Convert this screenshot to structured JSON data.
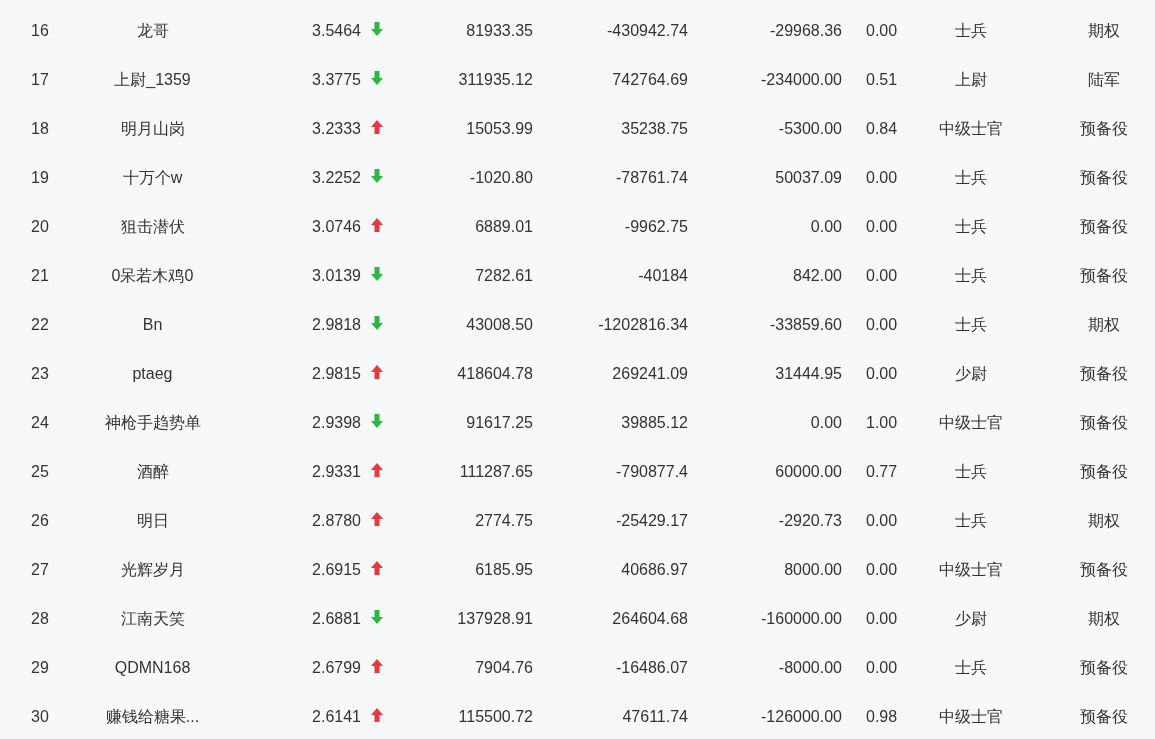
{
  "table": {
    "rows": [
      {
        "column_1": "16",
        "column_2": "龙哥",
        "column_3": "3.5464",
        "rising": false,
        "column_4": "81933.35",
        "column_5": "-430942.74",
        "column_6": "-29968.36",
        "column_7": "0.00",
        "column_8": "士兵",
        "column_9": "期权"
      },
      {
        "column_1": "17",
        "column_2": "上尉_1359",
        "column_3": "3.3775",
        "rising": false,
        "column_4": "311935.12",
        "column_5": "742764.69",
        "column_6": "-234000.00",
        "column_7": "0.51",
        "column_8": "上尉",
        "column_9": "陆军"
      },
      {
        "column_1": "18",
        "column_2": "明月山岗",
        "column_3": "3.2333",
        "rising": true,
        "column_4": "15053.99",
        "column_5": "35238.75",
        "column_6": "-5300.00",
        "column_7": "0.84",
        "column_8": "中级士官",
        "column_9": "预备役"
      },
      {
        "column_1": "19",
        "column_2": "十万个w",
        "column_3": "3.2252",
        "rising": false,
        "column_4": "-1020.80",
        "column_5": "-78761.74",
        "column_6": "50037.09",
        "column_7": "0.00",
        "column_8": "士兵",
        "column_9": "预备役"
      },
      {
        "column_1": "20",
        "column_2": "狙击潜伏",
        "column_3": "3.0746",
        "rising": true,
        "column_4": "6889.01",
        "column_5": "-9962.75",
        "column_6": "0.00",
        "column_7": "0.00",
        "column_8": "士兵",
        "column_9": "预备役"
      },
      {
        "column_1": "21",
        "column_2": "0呆若木鸡0",
        "column_3": "3.0139",
        "rising": false,
        "column_4": "7282.61",
        "column_5": "-40184",
        "column_6": "842.00",
        "column_7": "0.00",
        "column_8": "士兵",
        "column_9": "预备役"
      },
      {
        "column_1": "22",
        "column_2": "Bn",
        "column_3": "2.9818",
        "rising": false,
        "column_4": "43008.50",
        "column_5": "-1202816.34",
        "column_6": "-33859.60",
        "column_7": "0.00",
        "column_8": "士兵",
        "column_9": "期权"
      },
      {
        "column_1": "23",
        "column_2": "ptaeg",
        "column_3": "2.9815",
        "rising": true,
        "column_4": "418604.78",
        "column_5": "269241.09",
        "column_6": "31444.95",
        "column_7": "0.00",
        "column_8": "少尉",
        "column_9": "预备役"
      },
      {
        "column_1": "24",
        "column_2": "神枪手趋势单",
        "column_3": "2.9398",
        "rising": false,
        "column_4": "91617.25",
        "column_5": "39885.12",
        "column_6": "0.00",
        "column_7": "1.00",
        "column_8": "中级士官",
        "column_9": "预备役"
      },
      {
        "column_1": "25",
        "column_2": "酒醉",
        "column_3": "2.9331",
        "rising": true,
        "column_4": "111287.65",
        "column_5": "-790877.4",
        "column_6": "60000.00",
        "column_7": "0.77",
        "column_8": "士兵",
        "column_9": "预备役"
      },
      {
        "column_1": "26",
        "column_2": "明日",
        "column_3": "2.8780",
        "rising": true,
        "column_4": "2774.75",
        "column_5": "-25429.17",
        "column_6": "-2920.73",
        "column_7": "0.00",
        "column_8": "士兵",
        "column_9": "期权"
      },
      {
        "column_1": "27",
        "column_2": "光辉岁月",
        "column_3": "2.6915",
        "rising": true,
        "column_4": "6185.95",
        "column_5": "40686.97",
        "column_6": "8000.00",
        "column_7": "0.00",
        "column_8": "中级士官",
        "column_9": "预备役"
      },
      {
        "column_1": "28",
        "column_2": "江南天笑",
        "column_3": "2.6881",
        "rising": false,
        "column_4": "137928.91",
        "column_5": "264604.68",
        "column_6": "-160000.00",
        "column_7": "0.00",
        "column_8": "少尉",
        "column_9": "期权"
      },
      {
        "column_1": "29",
        "column_2": "QDMN168",
        "column_3": "2.6799",
        "rising": true,
        "column_4": "7904.76",
        "column_5": "-16486.07",
        "column_6": "-8000.00",
        "column_7": "0.00",
        "column_8": "士兵",
        "column_9": "预备役"
      },
      {
        "column_1": "30",
        "column_2": "赚钱给糖果...",
        "column_3": "2.6141",
        "rising": true,
        "column_4": "115500.72",
        "column_5": "47611.74",
        "column_6": "-126000.00",
        "column_7": "0.98",
        "column_8": "中级士官",
        "column_9": "预备役"
      }
    ]
  }
}
